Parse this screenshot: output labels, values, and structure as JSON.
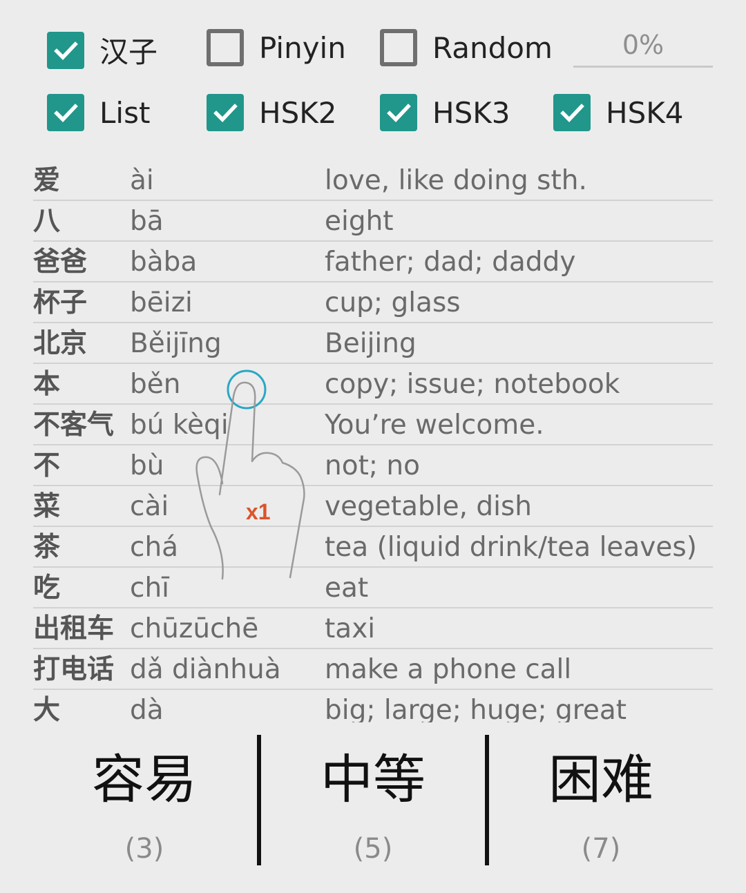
{
  "filters": {
    "row1": [
      {
        "label": "汉子",
        "checked": true
      },
      {
        "label": "Pinyin",
        "checked": false
      },
      {
        "label": "Random",
        "checked": false
      }
    ],
    "row2": [
      {
        "label": "List",
        "checked": true
      },
      {
        "label": "HSK2",
        "checked": true
      },
      {
        "label": "HSK3",
        "checked": true
      },
      {
        "label": "HSK4",
        "checked": true
      }
    ]
  },
  "progress": {
    "text": "0%",
    "value": 0
  },
  "colors": {
    "checkbox_on": "#21968b",
    "tap_indicator": "#29a7c4",
    "tap_count": "#d9542b"
  },
  "words": [
    {
      "hanzi": "爱",
      "pinyin": "ài",
      "english": "love, like doing sth."
    },
    {
      "hanzi": "八",
      "pinyin": "bā",
      "english": "eight"
    },
    {
      "hanzi": "爸爸",
      "pinyin": "bàba",
      "english": "father; dad; daddy"
    },
    {
      "hanzi": "杯子",
      "pinyin": "bēizi",
      "english": "cup; glass"
    },
    {
      "hanzi": "北京",
      "pinyin": "Běijīng",
      "english": "Beijing"
    },
    {
      "hanzi": "本",
      "pinyin": "běn",
      "english": "copy; issue; notebook"
    },
    {
      "hanzi": "不客气",
      "pinyin": "bú kèqi",
      "english": "You’re welcome."
    },
    {
      "hanzi": "不",
      "pinyin": "bù",
      "english": "not; no"
    },
    {
      "hanzi": "菜",
      "pinyin": "cài",
      "english": "vegetable, dish"
    },
    {
      "hanzi": "茶",
      "pinyin": "chá",
      "english": "tea (liquid drink/tea leaves)"
    },
    {
      "hanzi": "吃",
      "pinyin": "chī",
      "english": "eat"
    },
    {
      "hanzi": "出租车",
      "pinyin": "chūzūchē",
      "english": "taxi"
    },
    {
      "hanzi": "打电话",
      "pinyin": "dǎ diànhuà",
      "english": "make a phone call"
    },
    {
      "hanzi": "大",
      "pinyin": "dà",
      "english": "big; large; huge; great"
    }
  ],
  "difficulty": [
    {
      "label": "容易",
      "count": "(3)"
    },
    {
      "label": "中等",
      "count": "(5)"
    },
    {
      "label": "困难",
      "count": "(7)"
    }
  ],
  "gesture": {
    "icon": "tap-hand-icon",
    "count_label": "x1"
  }
}
